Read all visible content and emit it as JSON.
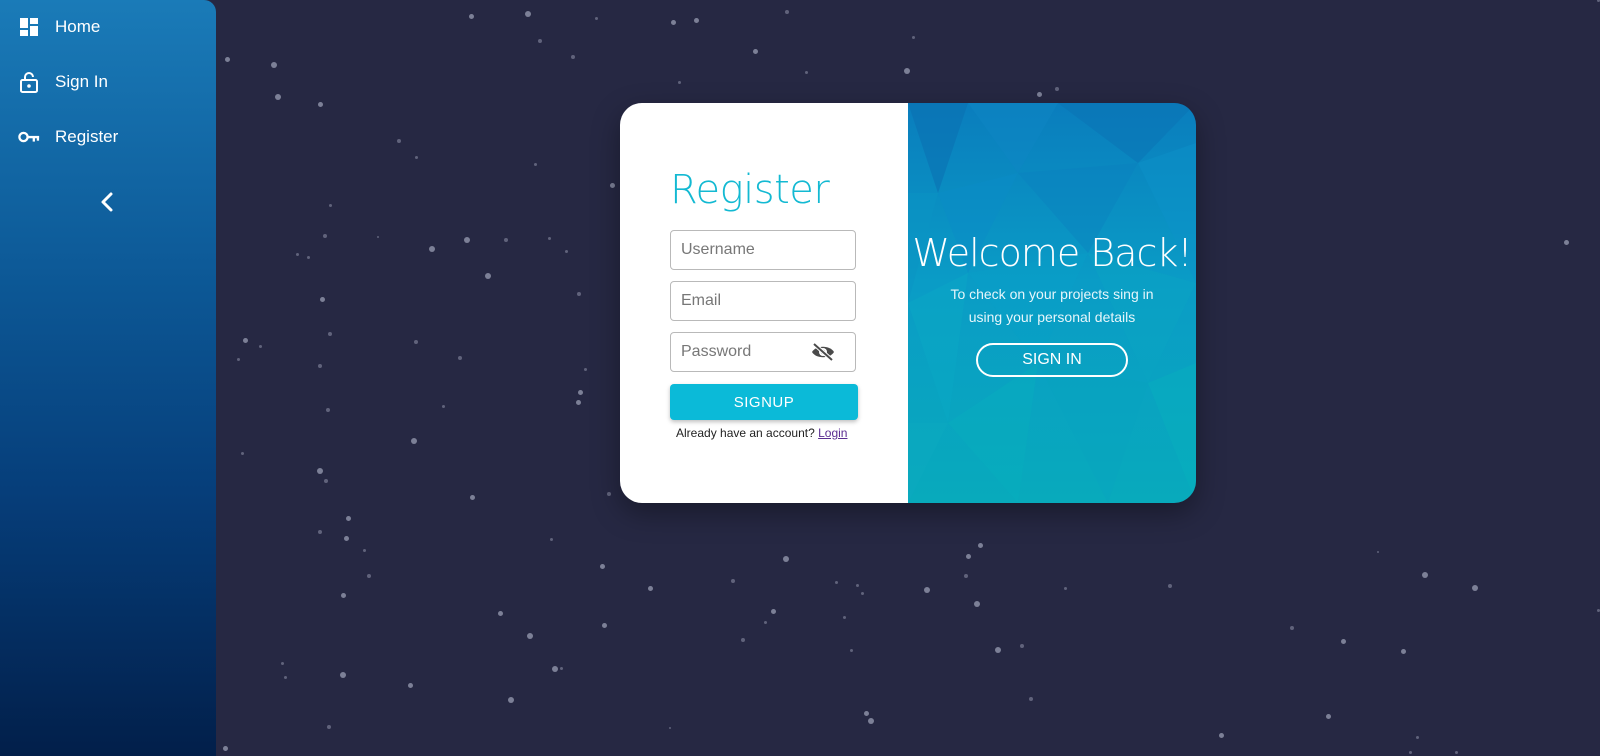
{
  "sidebar": {
    "items": [
      {
        "label": "Home",
        "icon": "dashboard-icon"
      },
      {
        "label": "Sign In",
        "icon": "lock-open-icon"
      },
      {
        "label": "Register",
        "icon": "key-icon"
      }
    ],
    "collapse_icon": "chevron-left-icon"
  },
  "register": {
    "title": "Register",
    "username_placeholder": "Username",
    "email_placeholder": "Email",
    "password_placeholder": "Password",
    "signup_label": "SIGNUP",
    "already_text": "Already have an account?",
    "login_link": "Login"
  },
  "welcome": {
    "title": "Welcome Back!",
    "description": "To check on your projects sing in using your personal details",
    "signin_label": "SIGN IN"
  },
  "colors": {
    "background": "#262843",
    "accent": "#0bbad8",
    "title": "#13b9d2",
    "link": "#5b2c91"
  }
}
